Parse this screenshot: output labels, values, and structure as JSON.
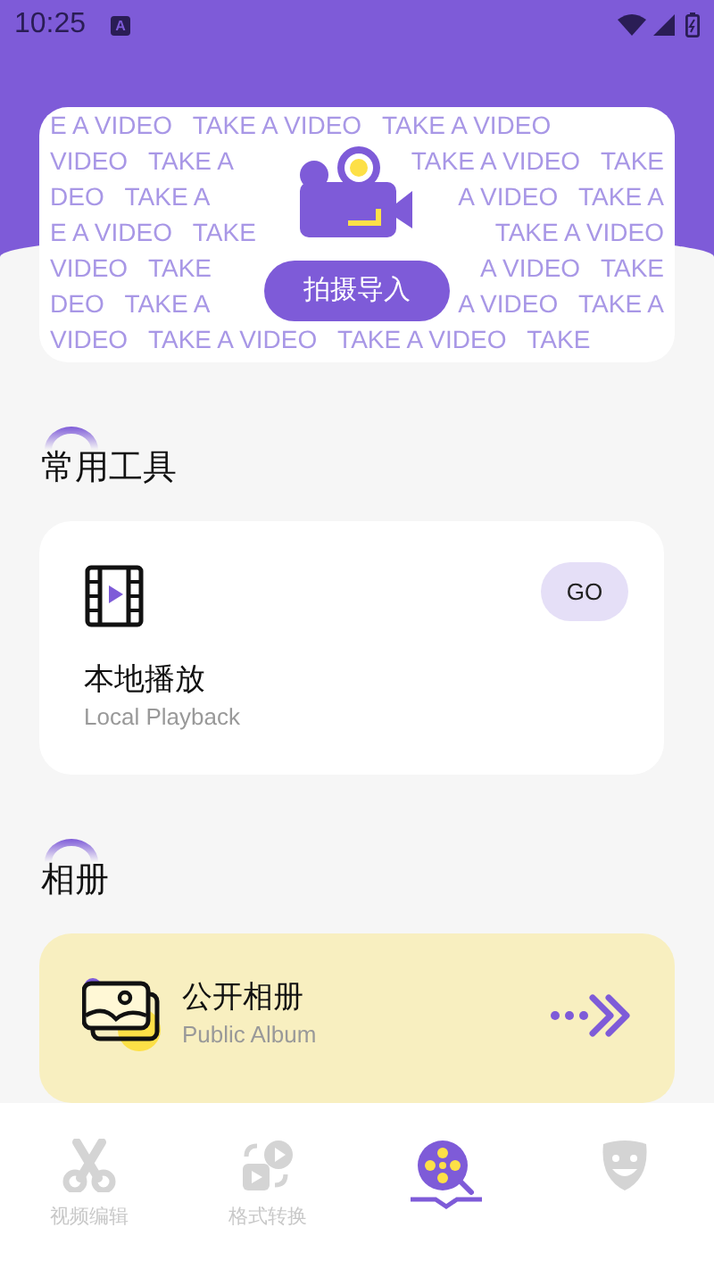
{
  "status_bar": {
    "time": "10:25",
    "notification": "A"
  },
  "banner": {
    "pattern_rows": [
      [
        "E A VIDEO   TAKE A VIDEO   TAKE A VIDEO"
      ],
      [
        "VIDEO   TAKE A",
        "TAKE A VIDEO   TAKE"
      ],
      [
        "DEO   TAKE A",
        "A VIDEO   TAKE A"
      ],
      [
        "E A VIDEO   TAKE",
        "TAKE A VIDEO"
      ],
      [
        "VIDEO   TAKE",
        "A VIDEO   TAKE"
      ],
      [
        "DEO   TAKE A",
        "A VIDEO   TAKE A"
      ],
      [
        "VIDEO   TAKE A VIDEO   TAKE A VIDEO   TAKE"
      ]
    ],
    "button": "拍摄导入"
  },
  "sections": [
    {
      "title": "常用工具",
      "card": {
        "kind": "tool",
        "title": "本地播放",
        "subtitle": "Local Playback",
        "action": "GO"
      }
    },
    {
      "title": "相册",
      "card": {
        "kind": "album",
        "title": "公开相册",
        "subtitle": "Public Album"
      }
    }
  ],
  "tabs": [
    {
      "label": "视频编辑",
      "selected": false
    },
    {
      "label": "格式转换",
      "selected": false
    },
    {
      "selected": true
    },
    {
      "selected": false
    }
  ]
}
